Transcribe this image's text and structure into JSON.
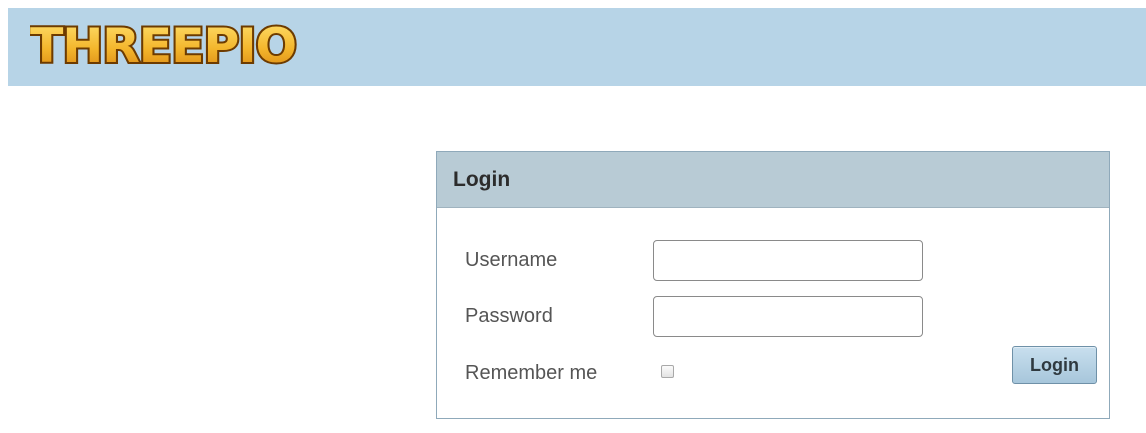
{
  "app": {
    "logo_text": "THREEPIO"
  },
  "colors": {
    "header_bg": "#b7d4e7",
    "panel_header_bg": "#b8cbd5",
    "button_bg": "#b4d2e6",
    "logo_fill": "#f3b52b",
    "logo_outline": "#6d3b00"
  },
  "login": {
    "title": "Login",
    "username_label": "Username",
    "username_value": "",
    "password_label": "Password",
    "password_value": "",
    "remember_label": "Remember me",
    "remember_checked": false,
    "submit_label": "Login"
  }
}
